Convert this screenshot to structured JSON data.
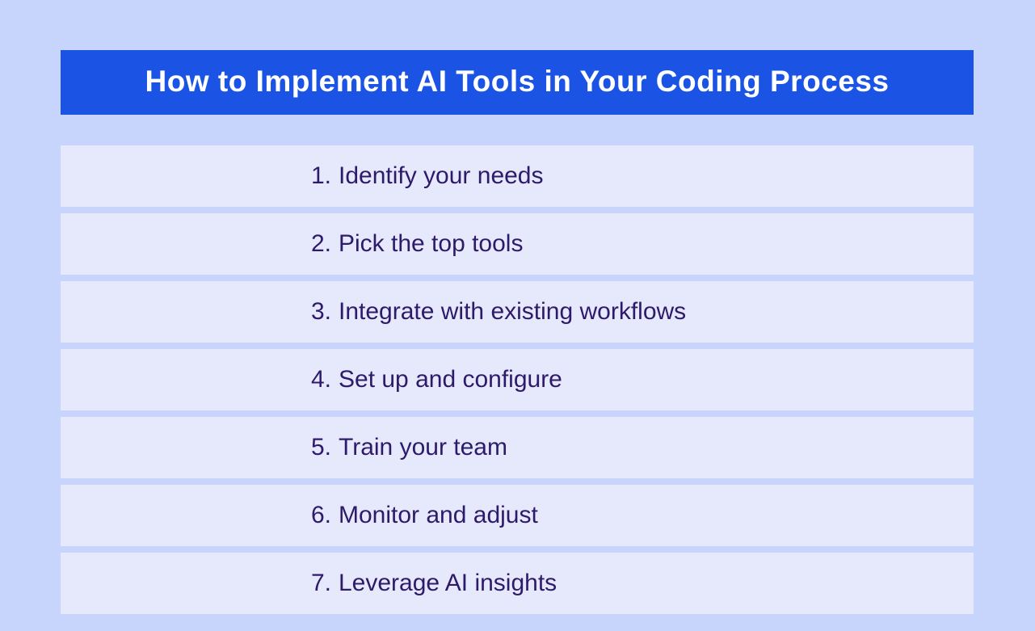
{
  "title": "How to Implement AI Tools in Your Coding Process",
  "steps": [
    {
      "num": "1.",
      "text": "Identify your needs"
    },
    {
      "num": "2.",
      "text": "Pick the top tools"
    },
    {
      "num": "3.",
      "text": "Integrate with existing workflows"
    },
    {
      "num": "4.",
      "text": "Set up and configure"
    },
    {
      "num": "5.",
      "text": "Train your team"
    },
    {
      "num": "6.",
      "text": "Monitor and adjust"
    },
    {
      "num": "7.",
      "text": "Leverage AI insights"
    }
  ],
  "colors": {
    "page_bg": "#c7d4fb",
    "title_bg": "#1b53e4",
    "title_fg": "#ffffff",
    "row_bg": "#e6e9fb",
    "row_fg": "#2d1a6b"
  }
}
